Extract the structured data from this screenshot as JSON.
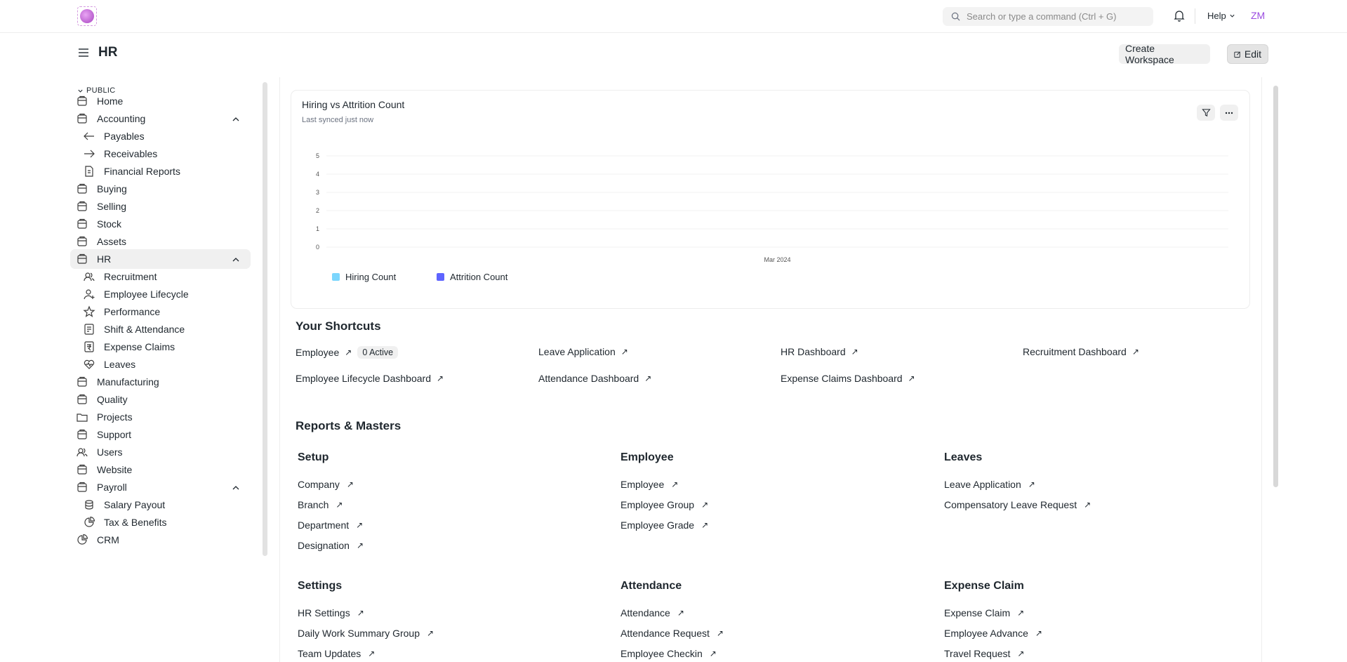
{
  "navbar": {
    "search_placeholder": "Search or type a command (Ctrl + G)",
    "help_label": "Help",
    "avatar_initials": "ZM"
  },
  "page": {
    "title": "HR",
    "create_workspace_label": "Create Workspace",
    "edit_label": "Edit"
  },
  "sidebar": {
    "section_label": "PUBLIC",
    "items": [
      {
        "label": "Home",
        "icon": "tools-icon"
      },
      {
        "label": "Accounting",
        "icon": "accounting-icon",
        "expanded": true
      },
      {
        "label": "Payables",
        "icon": "arrow-left-icon",
        "sub": true
      },
      {
        "label": "Receivables",
        "icon": "arrow-right-icon",
        "sub": true
      },
      {
        "label": "Financial Reports",
        "icon": "file-icon",
        "sub": true
      },
      {
        "label": "Buying",
        "icon": "buying-icon"
      },
      {
        "label": "Selling",
        "icon": "selling-icon"
      },
      {
        "label": "Stock",
        "icon": "stock-icon"
      },
      {
        "label": "Assets",
        "icon": "assets-icon"
      },
      {
        "label": "HR",
        "icon": "hr-icon",
        "expanded": true,
        "active": true
      },
      {
        "label": "Recruitment",
        "icon": "users-icon",
        "sub": true
      },
      {
        "label": "Employee Lifecycle",
        "icon": "user-add-icon",
        "sub": true
      },
      {
        "label": "Performance",
        "icon": "star-icon",
        "sub": true
      },
      {
        "label": "Shift & Attendance",
        "icon": "checklist-icon",
        "sub": true
      },
      {
        "label": "Expense Claims",
        "icon": "rupee-icon",
        "sub": true
      },
      {
        "label": "Leaves",
        "icon": "heart-icon",
        "sub": true
      },
      {
        "label": "Manufacturing",
        "icon": "factory-icon"
      },
      {
        "label": "Quality",
        "icon": "quality-icon"
      },
      {
        "label": "Projects",
        "icon": "folder-icon"
      },
      {
        "label": "Support",
        "icon": "headset-icon"
      },
      {
        "label": "Users",
        "icon": "users-icon"
      },
      {
        "label": "Website",
        "icon": "website-icon"
      },
      {
        "label": "Payroll",
        "icon": "payroll-icon",
        "expanded": true
      },
      {
        "label": "Salary Payout",
        "icon": "coins-icon",
        "sub": true
      },
      {
        "label": "Tax & Benefits",
        "icon": "pie-icon",
        "sub": true
      },
      {
        "label": "CRM",
        "icon": "crm-icon"
      }
    ]
  },
  "chart_card": {
    "title": "Hiring vs Attrition Count",
    "subtitle": "Last synced just now"
  },
  "chart_data": {
    "type": "line",
    "x": [
      "Mar 2024"
    ],
    "y_ticks": [
      0,
      1,
      2,
      3,
      4,
      5
    ],
    "ylim": [
      0,
      5
    ],
    "series": [
      {
        "name": "Hiring Count",
        "color": "#7cd6fd",
        "values": [
          0
        ]
      },
      {
        "name": "Attrition Count",
        "color": "#5e64ff",
        "values": [
          0
        ]
      }
    ]
  },
  "shortcuts": {
    "title": "Your Shortcuts",
    "items": [
      {
        "label": "Employee",
        "badge": "0 Active"
      },
      {
        "label": "Leave Application"
      },
      {
        "label": "HR Dashboard"
      },
      {
        "label": "Recruitment Dashboard"
      },
      {
        "label": "Employee Lifecycle Dashboard"
      },
      {
        "label": "Attendance Dashboard"
      },
      {
        "label": "Expense Claims Dashboard"
      }
    ]
  },
  "reports": {
    "title": "Reports & Masters",
    "groups": [
      {
        "title": "Setup",
        "links": [
          "Company",
          "Branch",
          "Department",
          "Designation"
        ]
      },
      {
        "title": "Employee",
        "links": [
          "Employee",
          "Employee Group",
          "Employee Grade"
        ]
      },
      {
        "title": "Leaves",
        "links": [
          "Leave Application",
          "Compensatory Leave Request"
        ]
      },
      {
        "title": "Settings",
        "links": [
          "HR Settings",
          "Daily Work Summary Group",
          "Team Updates"
        ]
      },
      {
        "title": "Attendance",
        "links": [
          "Attendance",
          "Attendance Request",
          "Employee Checkin"
        ]
      },
      {
        "title": "Expense Claim",
        "links": [
          "Expense Claim",
          "Employee Advance",
          "Travel Request"
        ]
      }
    ]
  }
}
